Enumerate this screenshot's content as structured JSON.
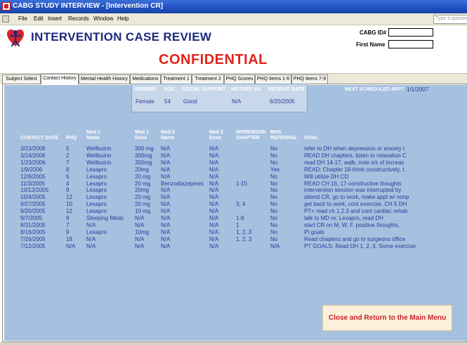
{
  "window": {
    "title": "CABG STUDY INTERVIEW - [Intervention CR]"
  },
  "menu": {
    "items": [
      "File",
      "Edit",
      "Insert",
      "Records",
      "Window",
      "Help"
    ],
    "ask_placeholder": "Type a question for help"
  },
  "header": {
    "title": "INTERVENTION CASE REVIEW",
    "confidential": "CONFIDENTIAL",
    "cabg_id_label": "CABG ID#",
    "cabg_id_value": "",
    "first_name_label": "First Name",
    "first_name_value": ""
  },
  "tabs": [
    {
      "label": "Subject Select",
      "active": false
    },
    {
      "label": "Contact History",
      "active": true
    },
    {
      "label": "Mental Health History",
      "active": false
    },
    {
      "label": "Medications",
      "active": false
    },
    {
      "label": "Treatment 1",
      "active": false
    },
    {
      "label": "Treatment 2",
      "active": false
    },
    {
      "label": "PHQ Scores",
      "active": false
    },
    {
      "label": "PHQ Items 1-6",
      "active": false
    },
    {
      "label": "PHQ Items 7-9",
      "active": false
    }
  ],
  "subject": {
    "headers": [
      "GENDER",
      "AGE",
      "SOCIAL SUPPORT",
      "HISTORY SA",
      "RECRUIT DATE"
    ],
    "values": [
      "Female",
      "54",
      "Good",
      "N/A",
      "6/20/2005"
    ]
  },
  "next_appt": {
    "label": "NEXT SCHEDULED APPT",
    "value": "1/1/2007"
  },
  "contacts": {
    "headers": [
      [
        "CONTACT DATE"
      ],
      [
        "PHQ"
      ],
      [
        "Med 1",
        "Name"
      ],
      [
        "Med 1",
        "Dose"
      ],
      [
        "Med 2",
        "Name"
      ],
      [
        "Med 2",
        "Dose"
      ],
      [
        "WORKBOOK",
        "CHAPTER"
      ],
      [
        "MHS",
        "REFERRAL"
      ],
      [
        "GOAL"
      ]
    ],
    "rows": [
      [
        "3/23/2006",
        "5",
        "Wellbutrin",
        "300 mg",
        "N/A",
        "N/A",
        "",
        "No",
        "refer to DH when depression or anxiety i"
      ],
      [
        "3/14/2006",
        "2",
        "Wellbutrin",
        "300mg",
        "N/A",
        "N/A",
        "",
        "No",
        "READ DH chapters, listen to relaxation C"
      ],
      [
        "1/23/2006",
        "7",
        "Wellbutrin",
        "300mg",
        "N/A",
        "N/A",
        "",
        "No",
        "read DH 14-17, walk, note s/s of increas"
      ],
      [
        "1/9/2006",
        "8",
        "Lexapro",
        "20mg",
        "N/A",
        "N/A",
        "",
        "Yes",
        "READ: Chapter 18-think constructively, t"
      ],
      [
        "12/8/2005",
        "6",
        "Lexapro",
        "20 mg",
        "N/A",
        "N/A",
        "",
        "No",
        "Will utilize DH CD"
      ],
      [
        "11/3/2005",
        "4",
        "Lexapro",
        "20 mg",
        "Benzodiazepines",
        "N/A",
        "1-15",
        "No",
        "READ CH 16, 17-constructive thoughts"
      ],
      [
        "10/12/2005",
        "9",
        "Lexapro",
        "20mg",
        "N/A",
        "N/A",
        "",
        "No",
        "intervention session was interrupted by"
      ],
      [
        "10/4/2005",
        "12",
        "Lexapro",
        "20 mg",
        "N/A",
        "N/A",
        "",
        "No",
        "attend CR, go to work, make appt w/ nonp"
      ],
      [
        "9/27/2005",
        "10",
        "Lexapro",
        "20 mg",
        "N/A",
        "N/A",
        "3, 4",
        "No",
        "get back to work, cont exercise, CH 5 DH"
      ],
      [
        "9/20/2005",
        "12",
        "Lexapro",
        "10 mg",
        "N/A",
        "N/A",
        "",
        "No",
        "PT= read ch 1,2,3 and cont cardiac rehab"
      ],
      [
        "9/7/2005",
        "9",
        "Sleeping Meds",
        "N/A",
        "N/A",
        "N/A",
        "1-8",
        "No",
        "talk to MD re: Lexapro, read DH"
      ],
      [
        "8/31/2005",
        "7",
        "N/A",
        "N/A",
        "N/A",
        "N/A",
        "1",
        "No",
        "start CR on M, W, F. positive thoughts,"
      ],
      [
        "8/16/2005",
        "9",
        "Lexapro",
        "10mg",
        "N/A",
        "N/A",
        "1, 2, 3",
        "No",
        "Pt goals"
      ],
      [
        "7/26/2005",
        "18",
        "N/A",
        "N/A",
        "N/A",
        "N/A",
        "1, 2, 3",
        "No",
        "Read chapters and go to surgeons office"
      ],
      [
        "7/12/2005",
        "N/A",
        "N/A",
        "N/A",
        "N/A",
        "N/A",
        "",
        "N/A",
        "PT GOALS: Read DH 1, 2, 3. Some exercise"
      ]
    ]
  },
  "close_button": "Close and Return to the Main Menu",
  "colors": {
    "title_navy": "#1b2a7c",
    "confidential_red": "#e2231a",
    "panel_blue": "#a6c0df",
    "value_blue": "#2a3a9a"
  }
}
